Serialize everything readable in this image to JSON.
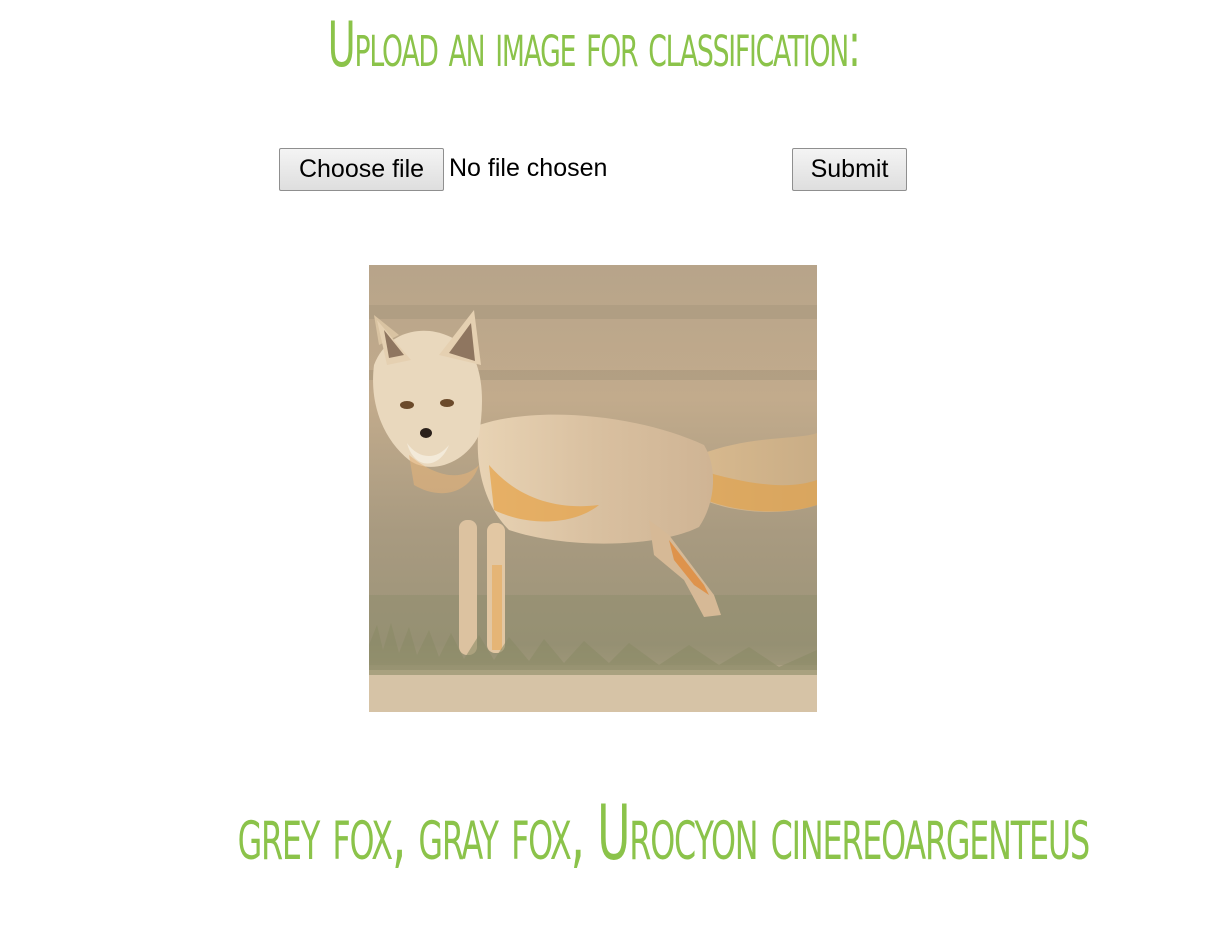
{
  "page": {
    "heading": "Upload an image for classification:",
    "accent_color": "#8bc34a"
  },
  "upload_form": {
    "choose_file_label": "Choose file",
    "file_status": "No file chosen",
    "submit_label": "Submit"
  },
  "preview": {
    "subject": "fox standing in a grassy field"
  },
  "result": {
    "label": "grey fox, gray fox, Urocyon cinereoargenteus"
  }
}
